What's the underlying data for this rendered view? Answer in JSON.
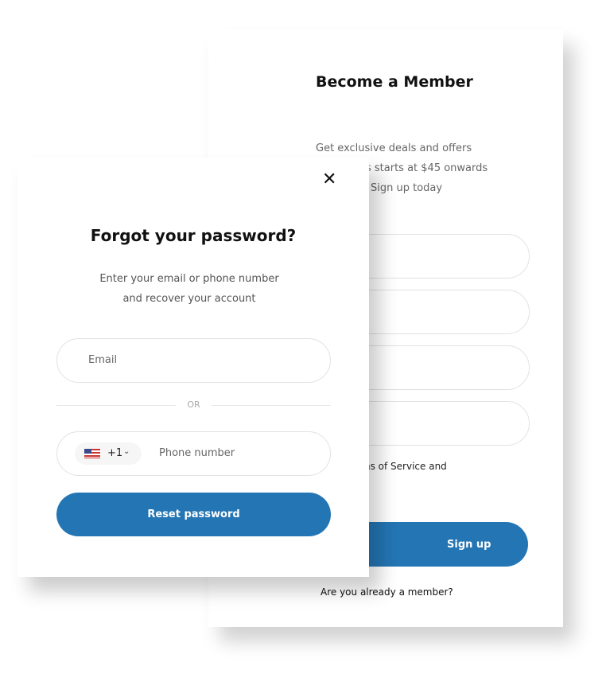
{
  "signup": {
    "title": "Become a Member",
    "lines": [
      "Get exclusive deals and offers",
      "s starts at $45 onwards",
      "Sign up today"
    ],
    "terms_fragment": "ns of Service and",
    "button": "Sign up",
    "member_link": "Are you already a member?"
  },
  "forgot": {
    "title": "Forgot your password?",
    "subtitle_lines": [
      "Enter your email or phone number",
      "and recover your account"
    ],
    "email_placeholder": "Email",
    "or_label": "OR",
    "country_code": "+1",
    "country_flag": "us-flag-icon",
    "phone_placeholder": "Phone number",
    "button": "Reset password"
  },
  "colors": {
    "accent": "#2475b4"
  }
}
